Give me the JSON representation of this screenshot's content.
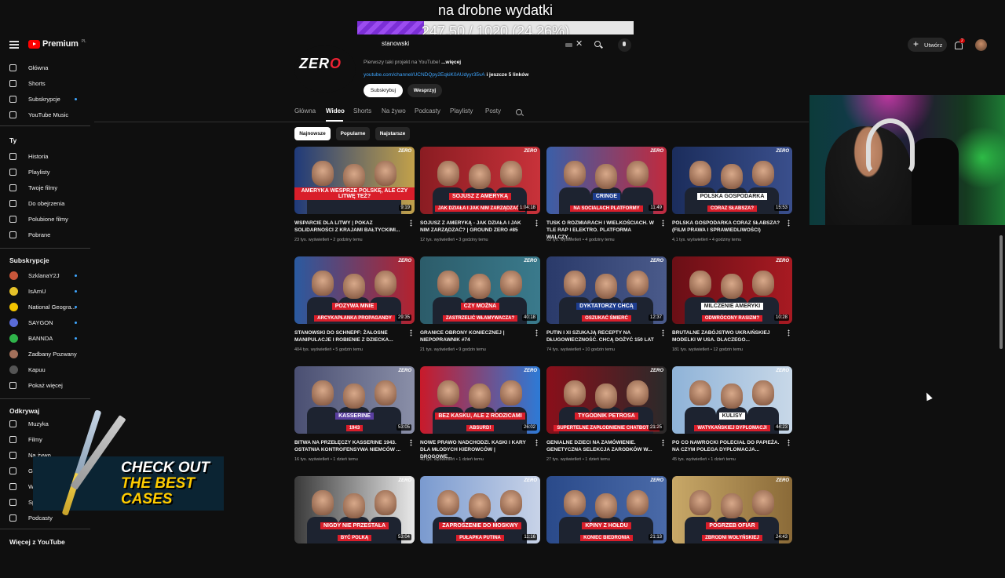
{
  "overlay": {
    "title": "na drobne wydatki",
    "progress_text": "247.50 / 1020 (24.26%)",
    "progress_fraction": 0.2426
  },
  "header": {
    "logo": "Premium",
    "logo_region": "PL",
    "search_value": "stanowski",
    "create_label": "Utwórz",
    "notification_count": "2"
  },
  "sidebar": {
    "main": [
      "Główna",
      "Shorts",
      "Subskrypcje",
      "YouTube Music"
    ],
    "you_heading": "Ty",
    "you_items": [
      "Historia",
      "Playlisty",
      "Twoje filmy",
      "Do obejrzenia",
      "Polubione filmy",
      "Pobrane"
    ],
    "subs_heading": "Subskrypcje",
    "subs": [
      {
        "name": "SzklanaY2J",
        "color": "#c8563a"
      },
      {
        "name": "IsAmU",
        "color": "#e6c229"
      },
      {
        "name": "National Geogra...",
        "color": "#f4c400"
      },
      {
        "name": "SAYGON",
        "color": "#5a6bd8"
      },
      {
        "name": "BANNDA",
        "color": "#2fb34a"
      },
      {
        "name": "Zadbany Pozwany",
        "color": "#a3705a"
      },
      {
        "name": "Kapuu",
        "color": "#555555"
      }
    ],
    "show_more": "Pokaż więcej",
    "explore_heading": "Odkrywaj",
    "explore": [
      "Muzyka",
      "Filmy",
      "Na żywo",
      "Gr",
      "W",
      "Sp",
      "Podcasty"
    ],
    "more_heading": "Więcej z YouTube"
  },
  "channel": {
    "logo_text": "ZER",
    "logo_text_red": "O",
    "desc_text": "Pierwszy taki projekt na YouTube! ",
    "desc_more": "...więcej",
    "link": "youtube.com/channel/UCNDQpy2EqkiK0AUdyyr35vA",
    "link_more": " i jeszcze 5 linków",
    "subscribe": "Subskrybuj",
    "join": "Wesprzyj"
  },
  "tabs": [
    "Główna",
    "Wideo",
    "Shorts",
    "Na żywo",
    "Podcasty",
    "Playlisty",
    "Posty"
  ],
  "active_tab": "Wideo",
  "chips": [
    "Najnowsze",
    "Popularne",
    "Najstarsze"
  ],
  "videos": [
    {
      "title": "WSPARCIE DLA LITWY | POKAZ SOLIDARNOŚCI Z KRAJAMI BAŁTYCKIMI...",
      "meta": "23 tys. wyświetleń • 2 godziny temu",
      "duration": "9:19",
      "caption": "AMERYKA WESPRZE POLSKĘ, ALE CZY LITWĘ TEŻ?",
      "bg1": "#1f3a7a",
      "bg2": "#c2a14a",
      "cap_bg": "#d91e2a"
    },
    {
      "title": "SOJUSZ Z AMERYKĄ - JAK DZIAŁA I JAK NIM ZARZĄDZAĆ? | GROUND ZERO #85",
      "meta": "12 tys. wyświetleń • 3 godziny temu",
      "duration": "1:04:18",
      "caption": "SOJUSZ Z AMERYKĄ",
      "sub_caption": "JAK DZIAŁA I JAK NIM ZARZĄDZAĆ?",
      "bg1": "#8a1c22",
      "bg2": "#c8323a",
      "cap_bg": "#d91e2a"
    },
    {
      "title": "TUSK O ROZMIARACH I WIELKOŚCIACH. W TLE RAP I ELEKTRO. PLATFORMA WALCZY...",
      "meta": "63 tys. wyświetleń • 4 godziny temu",
      "duration": "11:49",
      "caption": "CRINGE",
      "sub_caption": "NA SOCIALACH PLATFORMY",
      "bg1": "#3a5fa8",
      "bg2": "#c02a3e",
      "cap_bg": "#1d3d8f"
    },
    {
      "title": "POLSKA GOSPODARKA CORAZ SŁABSZA? (FILM PRAWA I SPRAWIEDLIWOŚCI)",
      "meta": "4,1 tys. wyświetleń • 4 godziny temu",
      "duration": "15:53",
      "caption": "POLSKA GOSPODARKA",
      "sub_caption": "CORAZ SŁABSZA?",
      "bg1": "#1b2d5c",
      "bg2": "#3a4f8c",
      "cap_bg": "#ffffff"
    },
    {
      "title": "STANOWSKI DO SCHNEPF: ŻAŁOSNE MANIPULACJE I ROBIENIE Z DZIECKA...",
      "meta": "404 tys. wyświetleń • 5 godzin temu",
      "duration": "29:35",
      "caption": "POZYWA MNIE",
      "sub_caption": "ARCYKAPŁANKA PROPAGANDY",
      "bg1": "#2a5aa0",
      "bg2": "#b4222e",
      "cap_bg": "#d91e2a"
    },
    {
      "title": "GRANICE OBRONY KONIECZNEJ | NIEPOPRAWNIK #74",
      "meta": "21 tys. wyświetleń • 9 godzin temu",
      "duration": "40:18",
      "caption": "CZY MOŻNA",
      "sub_caption": "ZASTRZELIĆ WŁAMYWACZA?",
      "bg1": "#2c5c6a",
      "bg2": "#3a7a8c",
      "cap_bg": "#d91e2a"
    },
    {
      "title": "PUTIN I XI SZUKAJĄ RECEPTY NA DŁUGOWIECZNOŚĆ. CHCĄ DOŻYĆ 150 LAT",
      "meta": "74 tys. wyświetleń • 10 godzin temu",
      "duration": "12:37",
      "caption": "DYKTATORZY CHCĄ",
      "sub_caption": "OSZUKAĆ ŚMIERĆ",
      "bg1": "#2a3a6a",
      "bg2": "#4a5a8a",
      "cap_bg": "#1d3d8f"
    },
    {
      "title": "BRUTALNE ZABÓJSTWO UKRAIŃSKIEJ MODELKI W USA. DLACZEGO...",
      "meta": "181 tys. wyświetleń • 12 godzin temu",
      "duration": "10:28",
      "caption": "MILCZENIE AMERYKI",
      "sub_caption": "ODWRÓCONY RASIZM?",
      "bg1": "#6a0f16",
      "bg2": "#a81a22",
      "cap_bg": "#ffffff"
    },
    {
      "title": "BITWA NA PRZEŁĘCZY KASSERINE 1943. OSTATNIA KONTROFENSYWA NIEMCÓW ...",
      "meta": "16 tys. wyświetleń • 1 dzień temu",
      "duration": "53:05",
      "caption": "KASSERINE",
      "sub_caption": "1943",
      "bg1": "#4a4f72",
      "bg2": "#8a8fa8",
      "cap_bg": "#5a3fa0"
    },
    {
      "title": "NOWE PRAWO NADCHODZI. KASKI I KARY DLA MŁODYCH KIEROWCÓW | DROGOWE...",
      "meta": "40 tys. wyświetleń • 1 dzień temu",
      "duration": "26:02",
      "caption": "BEZ KASKU, ALE Z RODZICAMI",
      "sub_caption": "ABSURD!",
      "bg1": "#c91a2a",
      "bg2": "#2d7ad6",
      "cap_bg": "#d91e2a"
    },
    {
      "title": "GENIALNE DZIECI NA ZAMÓWIENIE. GENETYCZNA SELEKCJA ZARODKÓW W...",
      "meta": "27 tys. wyświetleń • 1 dzień temu",
      "duration": "21:25",
      "caption": "TYGODNIK PETROSA",
      "sub_caption": "SUPERTELNE ZAPŁODNIENIE CHATBOTEM",
      "bg1": "#8a0f1a",
      "bg2": "#2a2a2a",
      "cap_bg": "#d91e2a"
    },
    {
      "title": "PO CO NAWROCKI POLECIAŁ DO PAPIEŻA. NA CZYM POLEGA DYPLOMACJA...",
      "meta": "45 tys. wyświetleń • 1 dzień temu",
      "duration": "44:23",
      "caption": "KULISY",
      "sub_caption": "WATYKAŃSKIEJ DYPLOMACJI",
      "bg1": "#8fb3d8",
      "bg2": "#c8d8e8",
      "cap_bg": "#ffffff"
    },
    {
      "title": "",
      "meta": "",
      "duration": "53:04",
      "caption": "NIGDY NIE PRZESTAŁA",
      "sub_caption": "BYĆ POLKĄ",
      "bg1": "#3a3a3a",
      "bg2": "#e8e8e8",
      "cap_bg": "#d91e2a"
    },
    {
      "title": "",
      "meta": "",
      "duration": "11:16",
      "caption": "ZAPROSZENIE DO MOSKWY",
      "sub_caption": "PUŁAPKA PUTINA",
      "bg1": "#7a9acf",
      "bg2": "#c8d3e8",
      "cap_bg": "#d91e2a"
    },
    {
      "title": "",
      "meta": "",
      "duration": "21:13",
      "caption": "KPINY Z HOŁDU",
      "sub_caption": "KONIEC BIEDRONIA",
      "bg1": "#2a4a8a",
      "bg2": "#4a6aa8",
      "cap_bg": "#d91e2a"
    },
    {
      "title": "",
      "meta": "",
      "duration": "24:43",
      "caption": "POGRZEB OFIAR",
      "sub_caption": "ZBRODNI WOŁYŃSKIEJ",
      "bg1": "#c8a868",
      "bg2": "#8a6a38",
      "cap_bg": "#d91e2a"
    }
  ],
  "promo": {
    "line1": "CHECK OUT",
    "line2": "THE BEST",
    "line3": "CASES"
  }
}
